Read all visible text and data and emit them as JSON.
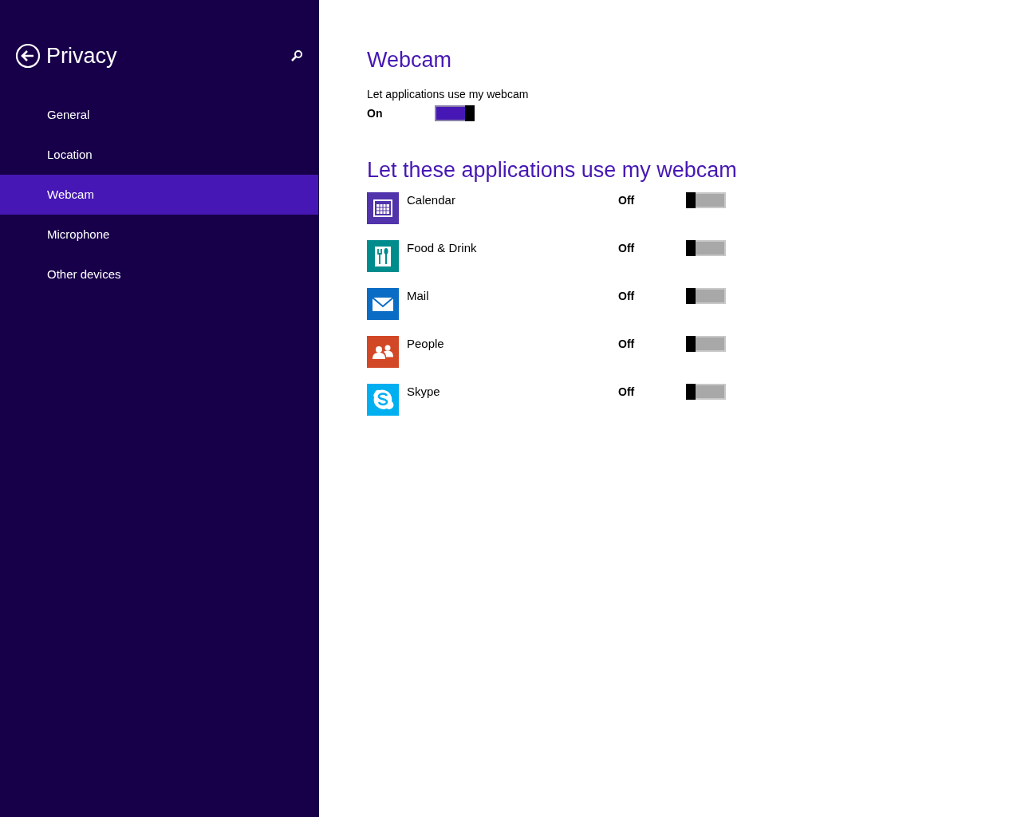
{
  "sidebar": {
    "title": "Privacy",
    "items": [
      {
        "label": "General",
        "selected": false
      },
      {
        "label": "Location",
        "selected": false
      },
      {
        "label": "Webcam",
        "selected": true
      },
      {
        "label": "Microphone",
        "selected": false
      },
      {
        "label": "Other devices",
        "selected": false
      }
    ]
  },
  "main": {
    "title": "Webcam",
    "master": {
      "label": "Let applications use my webcam",
      "state_text": "On",
      "on": true
    },
    "apps_heading": "Let these applications use my webcam",
    "apps": [
      {
        "name": "Calendar",
        "kind": "calendar",
        "color": "#5133ab",
        "state_text": "Off",
        "on": false
      },
      {
        "name": "Food & Drink",
        "kind": "food",
        "color": "#008c8c",
        "state_text": "Off",
        "on": false
      },
      {
        "name": "Mail",
        "kind": "mail",
        "color": "#0a6cc4",
        "state_text": "Off",
        "on": false
      },
      {
        "name": "People",
        "kind": "people",
        "color": "#d24726",
        "state_text": "Off",
        "on": false
      },
      {
        "name": "Skype",
        "kind": "skype",
        "color": "#00aff0",
        "state_text": "Off",
        "on": false
      }
    ]
  }
}
